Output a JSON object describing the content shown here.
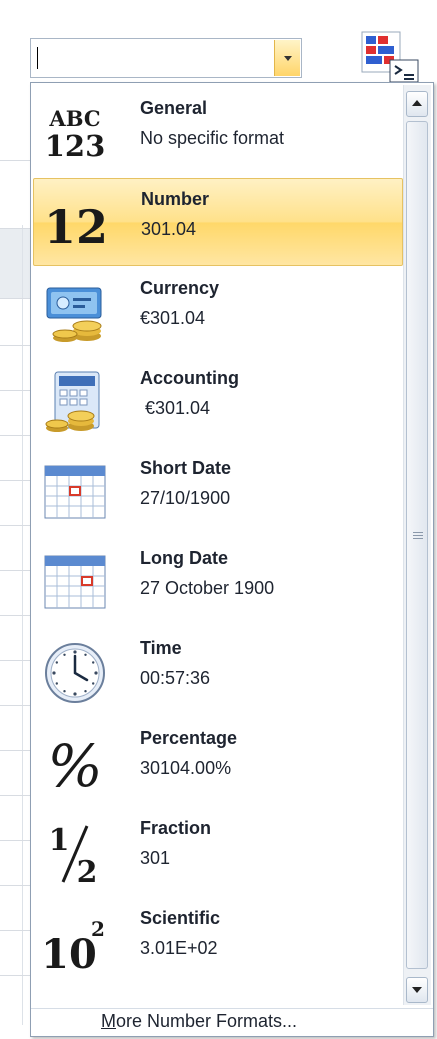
{
  "combo": {
    "value": ""
  },
  "format_items": [
    {
      "title": "General",
      "value": "No specific format",
      "icon": "abc-123-icon",
      "selected": false
    },
    {
      "title": "Number",
      "value": "301.04",
      "icon": "number-12-icon",
      "selected": true
    },
    {
      "title": "Currency",
      "value": "€301.04",
      "icon": "currency-icon",
      "selected": false
    },
    {
      "title": "Accounting",
      "value": " €301.04",
      "icon": "accounting-icon",
      "selected": false
    },
    {
      "title": "Short Date",
      "value": "27/10/1900",
      "icon": "short-date-calendar-icon",
      "selected": false
    },
    {
      "title": "Long Date",
      "value": "27 October 1900",
      "icon": "long-date-calendar-icon",
      "selected": false
    },
    {
      "title": "Time",
      "value": "00:57:36",
      "icon": "clock-icon",
      "selected": false
    },
    {
      "title": "Percentage",
      "value": "30104.00%",
      "icon": "percent-icon",
      "selected": false
    },
    {
      "title": "Fraction",
      "value": "301",
      "icon": "fraction-icon",
      "selected": false
    },
    {
      "title": "Scientific",
      "value": "3.01E+02",
      "icon": "scientific-icon",
      "selected": false
    }
  ],
  "footer": {
    "mnemonic": "M",
    "rest": "ore Number Formats..."
  },
  "icon_glyphs": {
    "abc": "ABC",
    "n123": "123",
    "n12": "12",
    "pct": "%",
    "ten": "10",
    "two": "2",
    "one": "1",
    "half_two": "2"
  },
  "colors": {
    "selected_bg": "#ffe18a",
    "selected_border": "#e6c262",
    "text": "#1e2430"
  }
}
